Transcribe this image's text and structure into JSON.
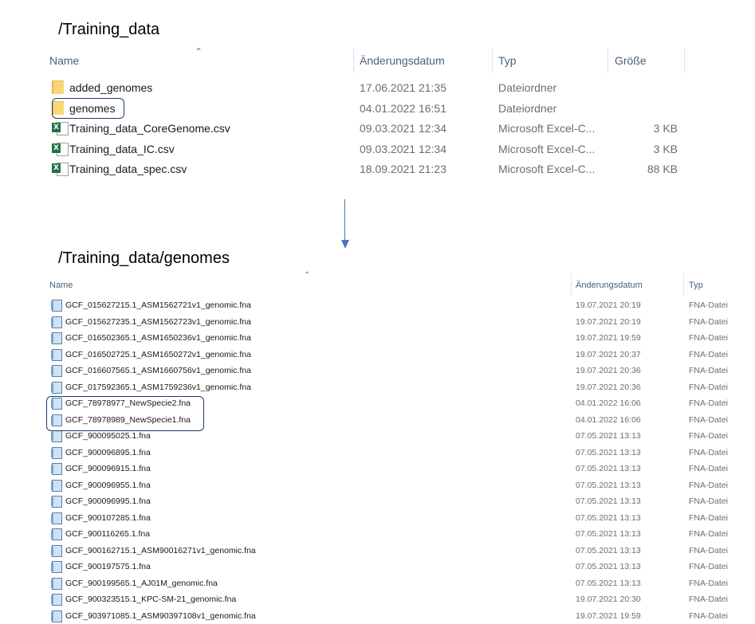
{
  "top": {
    "path": "/Training_data",
    "columns": {
      "name": "Name",
      "date": "Änderungsdatum",
      "type": "Typ",
      "size": "Größe"
    },
    "rows": [
      {
        "icon": "folder-icon",
        "name": "added_genomes",
        "date": "17.06.2021 21:35",
        "type": "Dateiordner",
        "size": ""
      },
      {
        "icon": "folder-icon",
        "name": "genomes",
        "date": "04.01.2022 16:51",
        "type": "Dateiordner",
        "size": "",
        "highlighted": true
      },
      {
        "icon": "excel-icon",
        "name": "Training_data_CoreGenome.csv",
        "date": "09.03.2021 12:34",
        "type": "Microsoft Excel-C...",
        "size": "3 KB"
      },
      {
        "icon": "excel-icon",
        "name": "Training_data_IC.csv",
        "date": "09.03.2021 12:34",
        "type": "Microsoft Excel-C...",
        "size": "3 KB"
      },
      {
        "icon": "excel-icon",
        "name": "Training_data_spec.csv",
        "date": "18.09.2021 21:23",
        "type": "Microsoft Excel-C...",
        "size": "88 KB"
      }
    ]
  },
  "bottom": {
    "path": "/Training_data/genomes",
    "columns": {
      "name": "Name",
      "date": "Änderungsdatum",
      "type": "Typ"
    },
    "rows": [
      {
        "name": "GCF_015627215.1_ASM1562721v1_genomic.fna",
        "date": "19.07.2021 20:19",
        "type": "FNA-Datei"
      },
      {
        "name": "GCF_015627235.1_ASM1562723v1_genomic.fna",
        "date": "19.07.2021 20:19",
        "type": "FNA-Datei"
      },
      {
        "name": "GCF_016502365.1_ASM1650236v1_genomic.fna",
        "date": "19.07.2021 19:59",
        "type": "FNA-Datei"
      },
      {
        "name": "GCF_016502725.1_ASM1650272v1_genomic.fna",
        "date": "19.07.2021 20:37",
        "type": "FNA-Datei"
      },
      {
        "name": "GCF_016607565.1_ASM1660756v1_genomic.fna",
        "date": "19.07.2021 20:36",
        "type": "FNA-Datei"
      },
      {
        "name": "GCF_017592365.1_ASM1759236v1_genomic.fna",
        "date": "19.07.2021 20:36",
        "type": "FNA-Datei"
      },
      {
        "name": "GCF_78978977_NewSpecie2.fna",
        "date": "04.01.2022 16:06",
        "type": "FNA-Datei",
        "highlighted": true
      },
      {
        "name": "GCF_78978989_NewSpecie1.fna",
        "date": "04.01.2022 16:06",
        "type": "FNA-Datei",
        "highlighted": true
      },
      {
        "name": "GCF_900095025.1.fna",
        "date": "07.05.2021 13:13",
        "type": "FNA-Datei"
      },
      {
        "name": "GCF_900096895.1.fna",
        "date": "07.05.2021 13:13",
        "type": "FNA-Datei"
      },
      {
        "name": "GCF_900096915.1.fna",
        "date": "07.05.2021 13:13",
        "type": "FNA-Datei"
      },
      {
        "name": "GCF_900096955.1.fna",
        "date": "07.05.2021 13:13",
        "type": "FNA-Datei"
      },
      {
        "name": "GCF_900096995.1.fna",
        "date": "07.05.2021 13:13",
        "type": "FNA-Datei"
      },
      {
        "name": "GCF_900107285.1.fna",
        "date": "07.05.2021 13:13",
        "type": "FNA-Datei"
      },
      {
        "name": "GCF_900116265.1.fna",
        "date": "07.05.2021 13:13",
        "type": "FNA-Datei"
      },
      {
        "name": "GCF_900162715.1_ASM90016271v1_genomic.fna",
        "date": "07.05.2021 13:13",
        "type": "FNA-Datei"
      },
      {
        "name": "GCF_900197575.1.fna",
        "date": "07.05.2021 13:13",
        "type": "FNA-Datei"
      },
      {
        "name": "GCF_900199565.1_AJ01M_genomic.fna",
        "date": "07.05.2021 13:13",
        "type": "FNA-Datei"
      },
      {
        "name": "GCF_900323515.1_KPC-SM-21_genomic.fna",
        "date": "19.07.2021 20:30",
        "type": "FNA-Datei"
      },
      {
        "name": "GCF_903971085.1_ASM90397108v1_genomic.fna",
        "date": "19.07.2021 19:59",
        "type": "FNA-Datei"
      }
    ]
  },
  "colors": {
    "highlight_border": "#1f3d66",
    "arrow": "#4a76b8",
    "header_text": "#4c607a"
  }
}
